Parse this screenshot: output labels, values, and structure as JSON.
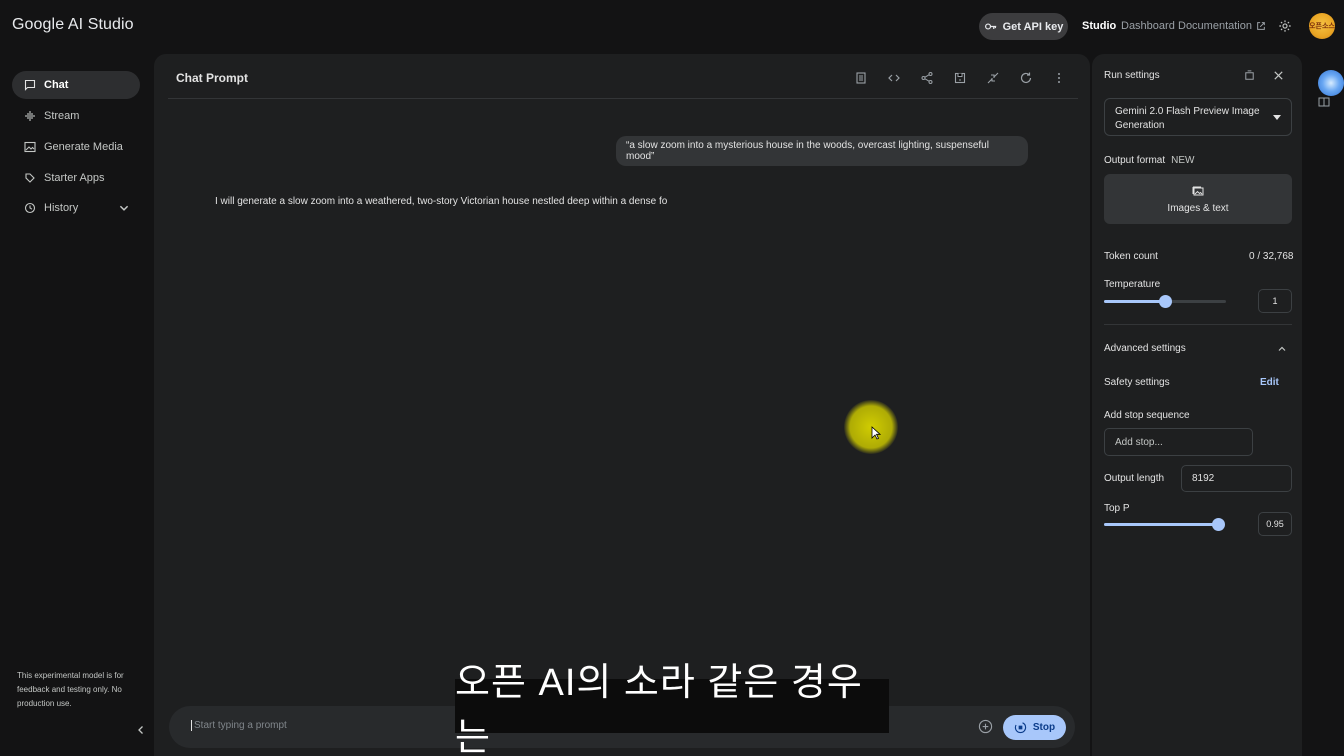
{
  "app": {
    "logo": "Google AI Studio",
    "get_api_key": "Get API key",
    "nav_studio": "Studio",
    "nav_dashboard": "Dashboard",
    "nav_documentation": "Documentation",
    "avatar_text": "오픈소스"
  },
  "sidebar": {
    "items": [
      {
        "label": "Chat",
        "icon": "chat-icon",
        "active": true
      },
      {
        "label": "Stream",
        "icon": "stream-icon",
        "active": false
      },
      {
        "label": "Generate Media",
        "icon": "image-icon",
        "active": false
      },
      {
        "label": "Starter Apps",
        "icon": "apps-icon",
        "active": false
      },
      {
        "label": "History",
        "icon": "history-icon",
        "active": false
      }
    ],
    "note": "This experimental model is for feedback and testing only. No production use."
  },
  "chat": {
    "title": "Chat Prompt",
    "user_message": "“a slow zoom into a mysterious house in the woods, overcast lighting, suspenseful mood”",
    "model_message": "I will generate a slow zoom into a weathered, two-story Victorian house nestled deep within a dense fo",
    "prompt_placeholder": "Start typing a prompt",
    "stop_label": "Stop"
  },
  "subtitle": "오픈 AI의 소라 같은 경우는",
  "run_settings": {
    "title": "Run settings",
    "model": "Gemini 2.0 Flash Preview Image Generation",
    "output_format_label": "Output format",
    "output_format_badge": "NEW",
    "output_format_value": "Images & text",
    "token_count_label": "Token count",
    "token_count_value": "0 / 32,768",
    "temperature_label": "Temperature",
    "temperature_value": "1",
    "temperature_fraction": 0.5,
    "advanced_label": "Advanced settings",
    "safety_label": "Safety settings",
    "safety_edit": "Edit",
    "stop_sequence_label": "Add stop sequence",
    "stop_sequence_placeholder": "Add stop...",
    "output_length_label": "Output length",
    "output_length_value": "8192",
    "top_p_label": "Top P",
    "top_p_value": "0.95",
    "top_p_fraction": 0.95
  },
  "colors": {
    "accent": "#a8c7fa",
    "background": "#131314",
    "panel": "#1e1f20"
  }
}
